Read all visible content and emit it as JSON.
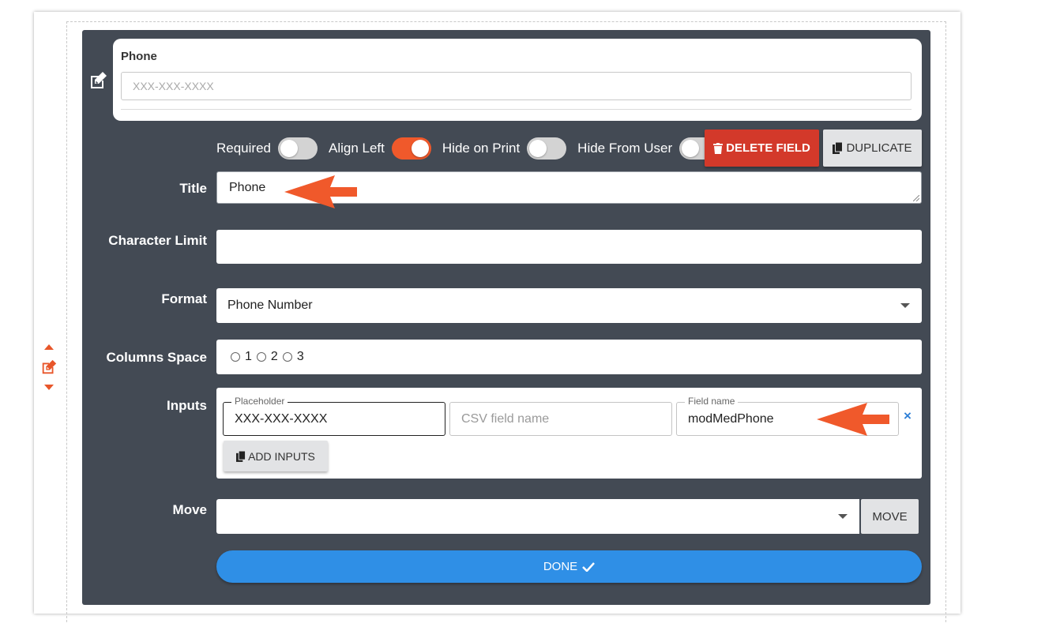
{
  "preview": {
    "title": "Phone",
    "placeholder": "XXX-XXX-XXXX"
  },
  "toggles": [
    {
      "label": "Required",
      "on": false
    },
    {
      "label": "Align Left",
      "on": true
    },
    {
      "label": "Hide on Print",
      "on": false
    },
    {
      "label": "Hide From User",
      "on": false
    }
  ],
  "buttons": {
    "delete_label": "DELETE FIELD",
    "duplicate_label": "DUPLICATE",
    "add_inputs_label": "ADD INPUTS",
    "move_label": "MOVE",
    "done_label": "DONE"
  },
  "form": {
    "title_label": "Title",
    "title_value": "Phone",
    "char_limit_label": "Character Limit",
    "char_limit_value": "",
    "format_label": "Format",
    "format_value": "Phone Number",
    "columns_label": "Columns Space",
    "columns_options": [
      "1",
      "2",
      "3"
    ],
    "inputs_label": "Inputs",
    "move_label": "Move",
    "move_value": ""
  },
  "inputs_row": {
    "placeholder_label": "Placeholder",
    "placeholder_value": "XXX-XXX-XXXX",
    "csv_placeholder": "CSV field name",
    "field_name_label": "Field name",
    "field_name_value": "modMedPhone",
    "remove_symbol": "×"
  },
  "colors": {
    "panel": "#434a54",
    "accent_orange": "#f0592b",
    "delete_red": "#d3392a",
    "done_blue": "#2f8fe6",
    "remove_blue": "#2e7fd6"
  }
}
